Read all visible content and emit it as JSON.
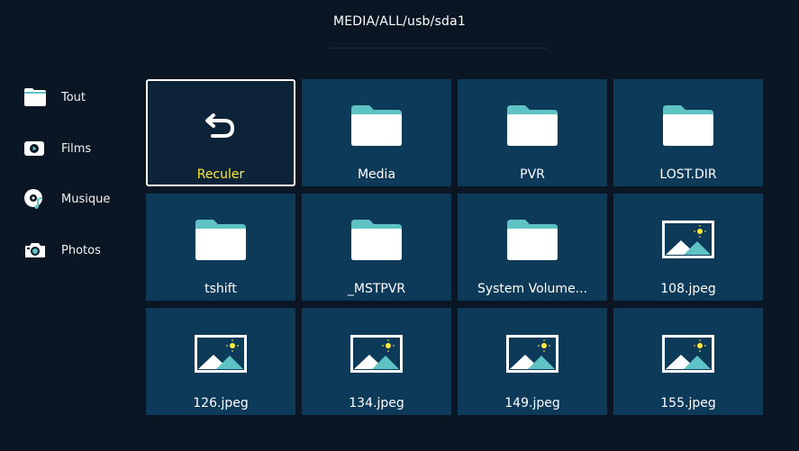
{
  "header": {
    "path": "MEDIA/ALL/usb/sda1"
  },
  "colors": {
    "background": "#0b1624",
    "tile": "#0e3a5a",
    "selected_label": "#ffea3a",
    "folder_tab": "#5fc3c6"
  },
  "sidebar": {
    "items": [
      {
        "label": "Tout",
        "icon": "folder-icon"
      },
      {
        "label": "Films",
        "icon": "film-icon"
      },
      {
        "label": "Musique",
        "icon": "music-icon"
      },
      {
        "label": "Photos",
        "icon": "camera-icon"
      }
    ]
  },
  "grid": {
    "tiles": [
      {
        "label": "Reculer",
        "type": "back",
        "selected": true
      },
      {
        "label": "Media",
        "type": "folder"
      },
      {
        "label": "PVR",
        "type": "folder"
      },
      {
        "label": "LOST.DIR",
        "type": "folder"
      },
      {
        "label": "tshift",
        "type": "folder"
      },
      {
        "label": "_MSTPVR",
        "type": "folder"
      },
      {
        "label": "System Volume...",
        "type": "folder"
      },
      {
        "label": "108.jpeg",
        "type": "image"
      },
      {
        "label": "126.jpeg",
        "type": "image"
      },
      {
        "label": "134.jpeg",
        "type": "image"
      },
      {
        "label": "149.jpeg",
        "type": "image"
      },
      {
        "label": "155.jpeg",
        "type": "image"
      }
    ]
  }
}
